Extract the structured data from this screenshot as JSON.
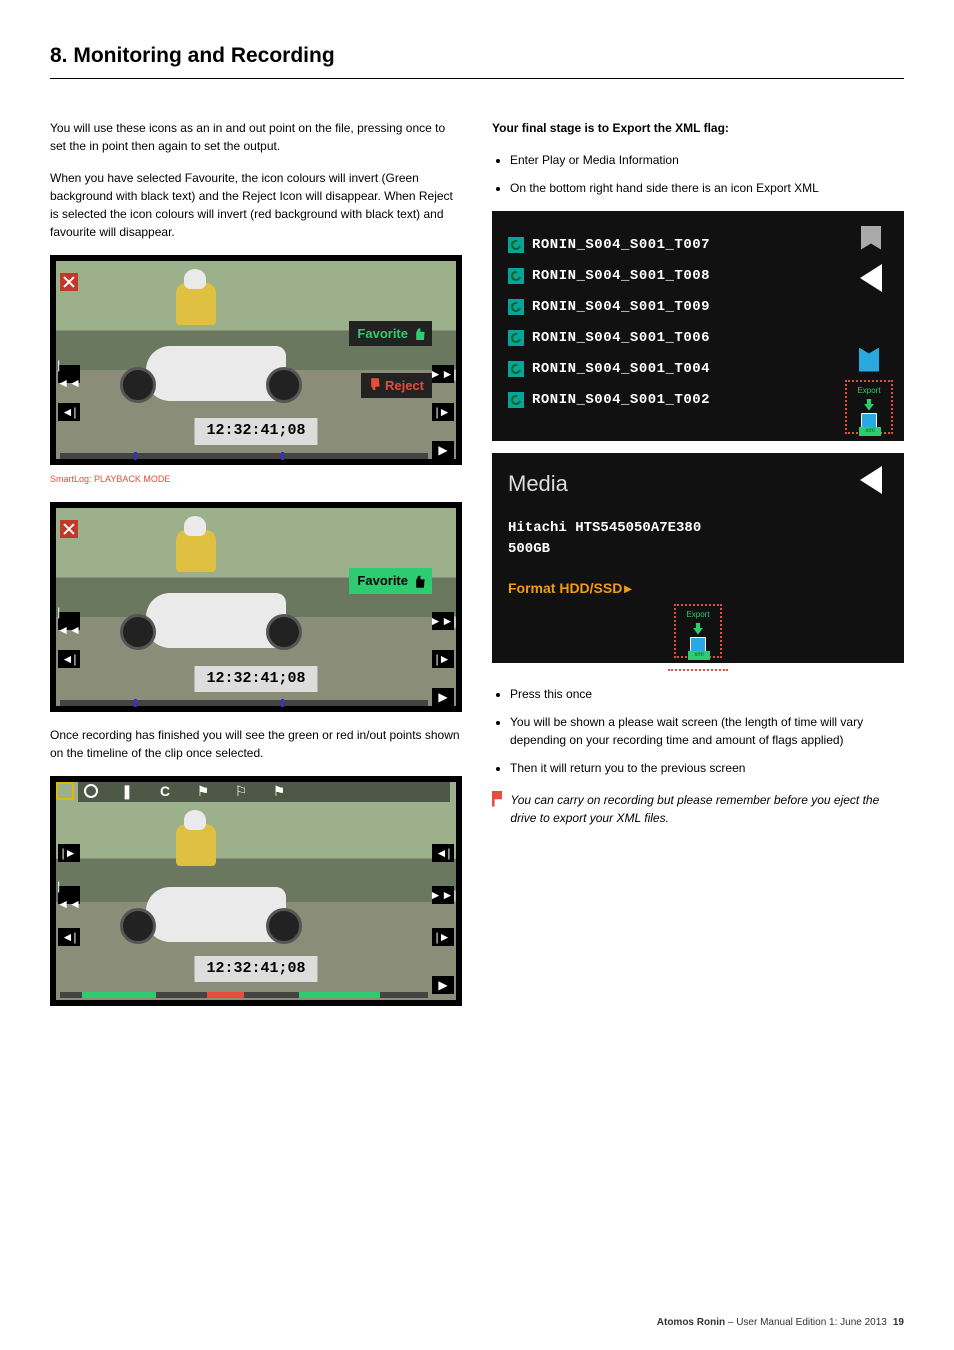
{
  "section_title": "8. Monitoring and Recording",
  "left": {
    "p1": "You will use these icons as an in and out point on the file, pressing once to set the in point then again to set the output.",
    "p2": "When you have selected Favourite, the icon colours will invert (Green background with black text) and the Reject Icon will disappear. When Reject is selected the icon colours will invert (red background with black text) and favourite will disappear.",
    "caption1": "SmartLog: PLAYBACK MODE",
    "p3": "Once recording has finished you will see the green or red in/out points shown on the timeline of the clip once selected.",
    "favorite_label": "Favorite",
    "reject_label": "Reject",
    "timecode": "12:32:41;08"
  },
  "right": {
    "h1": "Your final stage is to Export the XML flag:",
    "b1": "Enter Play or Media Information",
    "b2": "On the bottom right hand side there is an icon Export XML",
    "clips": [
      "RONIN_S004_S001_T007",
      "RONIN_S004_S001_T008",
      "RONIN_S004_S001_T009",
      "RONIN_S004_S001_T006",
      "RONIN_S004_S001_T004",
      "RONIN_S004_S001_T002"
    ],
    "export_label": "Export",
    "xml_label": "xml",
    "media_title": "Media",
    "media_drive": "Hitachi HTS545050A7E380",
    "media_size": "500GB",
    "format_label": "Format HDD/SSD",
    "b3": "Press this once",
    "b4": "You will be shown a please wait screen (the length of time will vary depending on your recording time and amount of flags applied)",
    "b5": "Then it will return you to the previous screen",
    "note": "You can carry on recording but please remember before you eject the drive to export your XML files."
  },
  "footer": {
    "product": "Atomos Ronin",
    "edition": " – User Manual Edition 1: June 2013",
    "page": "19"
  }
}
